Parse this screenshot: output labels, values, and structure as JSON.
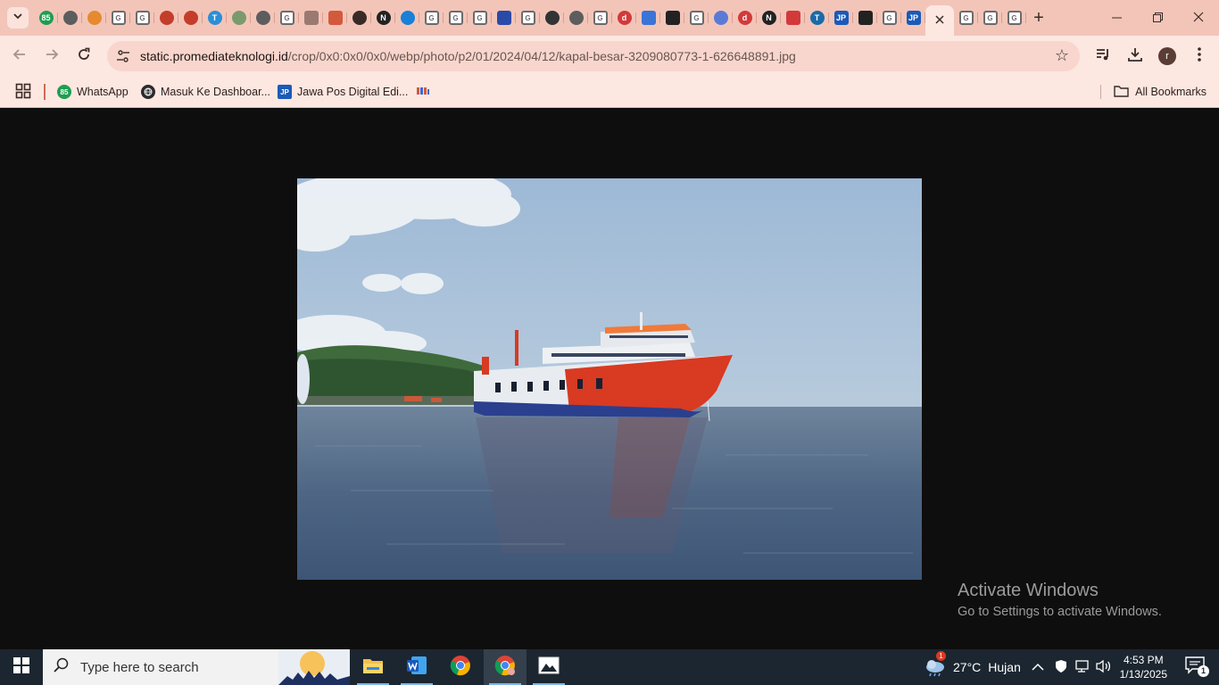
{
  "browser": {
    "tab_favicons": [
      {
        "icon": "sheets-badge-icon",
        "text": "85",
        "color": "#1e9e52"
      },
      {
        "icon": "globe-icon",
        "text": "",
        "color": "#5d5d5d"
      },
      {
        "icon": "site-icon",
        "text": "",
        "color": "#e58a2e"
      },
      {
        "icon": "google-icon",
        "text": "G",
        "color": "#6b6b6b"
      },
      {
        "icon": "google-icon",
        "text": "G",
        "color": "#6b6b6b"
      },
      {
        "icon": "shield-icon",
        "text": "",
        "color": "#c43d2a"
      },
      {
        "icon": "shield-icon",
        "text": "",
        "color": "#c43d2a"
      },
      {
        "icon": "t-icon",
        "text": "T",
        "color": "#2b8fd6"
      },
      {
        "icon": "puzzle-icon",
        "text": "",
        "color": "#7a9a6e"
      },
      {
        "icon": "globe-icon",
        "text": "",
        "color": "#5d5d5d"
      },
      {
        "icon": "google-icon",
        "text": "G",
        "color": "#6b6b6b"
      },
      {
        "icon": "bars-icon",
        "text": "",
        "color": "#9a7a70"
      },
      {
        "icon": "jpnn-icon",
        "text": "",
        "color": "#d25a3a"
      },
      {
        "icon": "speaker-icon",
        "text": "",
        "color": "#3a2a26"
      },
      {
        "icon": "n-icon",
        "text": "N",
        "color": "#222222"
      },
      {
        "icon": "search-site-icon",
        "text": "",
        "color": "#1a7fd6"
      },
      {
        "icon": "google-icon",
        "text": "G",
        "color": "#6b6b6b"
      },
      {
        "icon": "google-icon",
        "text": "G",
        "color": "#6b6b6b"
      },
      {
        "icon": "google-icon",
        "text": "G",
        "color": "#6b6b6b"
      },
      {
        "icon": "flag-icon",
        "text": "",
        "color": "#2a4aa8"
      },
      {
        "icon": "google-icon",
        "text": "G",
        "color": "#6b6b6b"
      },
      {
        "icon": "globe-dark-icon",
        "text": "",
        "color": "#333333"
      },
      {
        "icon": "globe-icon",
        "text": "",
        "color": "#5d5d5d"
      },
      {
        "icon": "google-icon",
        "text": "G",
        "color": "#6b6b6b"
      },
      {
        "icon": "d-icon",
        "text": "d",
        "color": "#d23a3a"
      },
      {
        "icon": "docs-icon",
        "text": "",
        "color": "#3a74d6"
      },
      {
        "icon": "oo-icon",
        "text": "",
        "color": "#222222"
      },
      {
        "icon": "google-icon",
        "text": "G",
        "color": "#6b6b6b"
      },
      {
        "icon": "globe-blue-icon",
        "text": "",
        "color": "#5a7ad6"
      },
      {
        "icon": "d-icon",
        "text": "d",
        "color": "#d23a3a"
      },
      {
        "icon": "n-icon",
        "text": "N",
        "color": "#222222"
      },
      {
        "icon": "flag-red-icon",
        "text": "",
        "color": "#d23a3a"
      },
      {
        "icon": "t-circle-icon",
        "text": "T",
        "color": "#1a6aa8"
      },
      {
        "icon": "jp-icon",
        "text": "JP",
        "color": "#1a5ab8"
      },
      {
        "icon": "oo-icon",
        "text": "",
        "color": "#222222"
      },
      {
        "icon": "google-icon",
        "text": "G",
        "color": "#6b6b6b"
      },
      {
        "icon": "jp-icon",
        "text": "JP",
        "color": "#1a5ab8"
      }
    ],
    "trailing_tabs": [
      {
        "icon": "google-icon",
        "text": "G"
      },
      {
        "icon": "google-icon",
        "text": "G"
      },
      {
        "icon": "google-icon",
        "text": "G"
      }
    ],
    "url_host": "static.promediateknologi.id",
    "url_path": "/crop/0x0:0x0/0x0/webp/photo/p2/01/2024/04/12/kapal-besar-3209080773-1-626648891.jpg",
    "profile_initial": "r",
    "bookmarks": [
      {
        "label": "WhatsApp",
        "icon": "whatsapp-icon",
        "badge": "85",
        "color": "#1e9e52"
      },
      {
        "label": "Masuk Ke Dashboar...",
        "icon": "globe-dark-icon",
        "badge": "",
        "color": "#2a2a2a"
      },
      {
        "label": "Jawa Pos Digital Edi...",
        "icon": "jp-icon",
        "badge": "JP",
        "color": "#1a5ab8"
      },
      {
        "label": "",
        "icon": "jpnn-icon",
        "badge": "",
        "color": "#d25a3a"
      }
    ],
    "all_bookmarks": "All Bookmarks"
  },
  "watermark": {
    "line1": "Activate Windows",
    "line2": "Go to Settings to activate Windows."
  },
  "taskbar": {
    "search_placeholder": "Type here to search",
    "weather_temp": "27°C",
    "weather_desc": "Hujan",
    "weather_badge": "1",
    "time": "4:53 PM",
    "date": "1/13/2025",
    "notification_count": "1"
  }
}
